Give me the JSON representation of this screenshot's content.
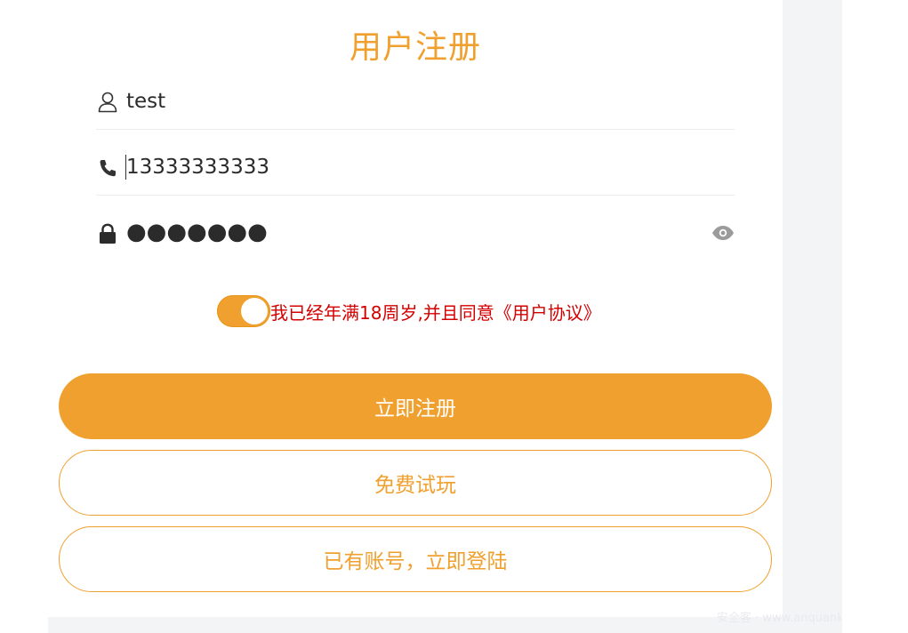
{
  "form": {
    "title": "用户注册",
    "username_value": "test",
    "phone_value": "13333333333",
    "password_masked": "●●●●●●●",
    "agreement_text": "我已经年满18周岁,并且同意《用户协议》",
    "agreement_checked": true
  },
  "buttons": {
    "register_label": "立即注册",
    "trial_label": "免费试玩",
    "login_label": "已有账号，立即登陆"
  },
  "watermark": "安全客 · www.anquanke.com",
  "colors": {
    "accent": "#f0a02e",
    "agreement_text": "#d40000",
    "background_gray": "#f3f4f6"
  },
  "icons": {
    "username": "user-icon",
    "phone": "phone-icon",
    "password": "lock-icon",
    "toggle_visibility": "eye-icon"
  }
}
